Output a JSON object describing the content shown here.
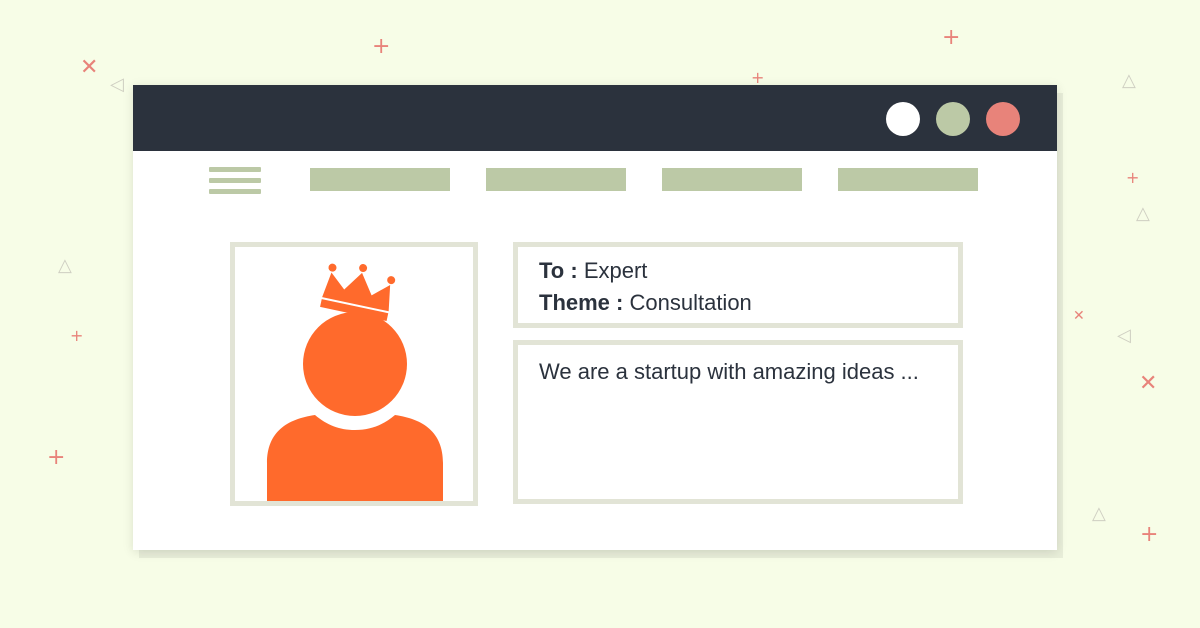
{
  "colors": {
    "background": "#f7fde7",
    "titlebar": "#2b323d",
    "nav_block": "#bcc9a6",
    "frame_border": "#e2e4d6",
    "avatar": "#ff6a2c",
    "decoration_accent": "#e8837a"
  },
  "window_controls": [
    {
      "name": "white-dot",
      "color": "#ffffff"
    },
    {
      "name": "green-dot",
      "color": "#bcc9a6"
    },
    {
      "name": "red-dot",
      "color": "#e8837a"
    }
  ],
  "nav": {
    "menu_icon": "hamburger-menu-icon",
    "items": 4
  },
  "profile": {
    "avatar_icon": "user-with-crown-icon"
  },
  "message": {
    "to_label": "To :",
    "to_value": "Expert",
    "theme_label": "Theme :",
    "theme_value": "Consultation",
    "body": "We are a startup with amazing ideas ..."
  }
}
